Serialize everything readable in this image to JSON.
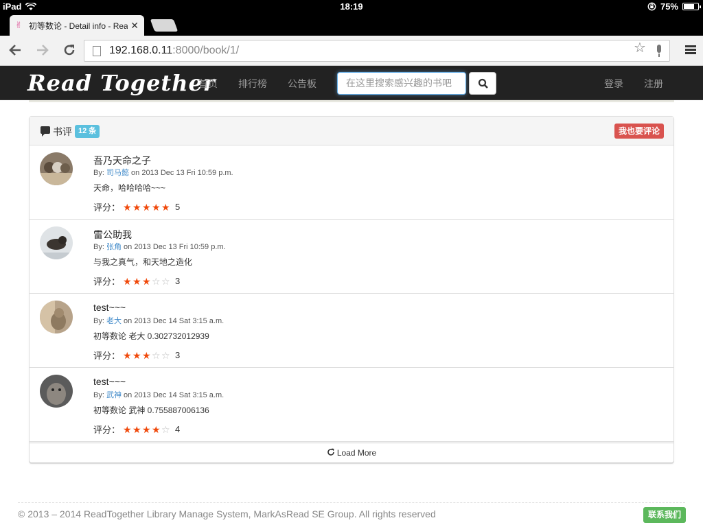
{
  "status_bar": {
    "device": "iPad",
    "time": "18:19",
    "battery": "75%",
    "battery_level": 0.75
  },
  "browser": {
    "tab_title": "初等数论 - Detail info - Rea",
    "url_host": "192.168.0.11",
    "url_path": ":8000/book/1/"
  },
  "navbar": {
    "brand": "Read Together",
    "links": [
      "首页",
      "排行榜",
      "公告板"
    ],
    "search_placeholder": "在这里搜索感兴趣的书吧",
    "login": "登录",
    "register": "注册"
  },
  "reviews_panel": {
    "heading": "书评",
    "count_badge": "12 条",
    "add_review_button": "我也要评论",
    "load_more": "Load More",
    "rating_label": "评分：",
    "by_label": "By:",
    "items": [
      {
        "title": "吾乃天命之子",
        "user": "司马懿",
        "date": "on 2013 Dec 13 Fri 10:59 p.m.",
        "body": "天命，哈哈哈哈~~~",
        "rating": 5,
        "rating_text": "5"
      },
      {
        "title": "雷公助我",
        "user": "张角",
        "date": "on 2013 Dec 13 Fri 10:59 p.m.",
        "body": "与我之真气，和天地之造化",
        "rating": 3,
        "rating_text": "3"
      },
      {
        "title": "test~~~",
        "user": "老大",
        "date": "on 2013 Dec 14 Sat 3:15 a.m.",
        "body": "初等数论 老大 0.302732012939",
        "rating": 3,
        "rating_text": "3"
      },
      {
        "title": "test~~~",
        "user": "武神",
        "date": "on 2013 Dec 14 Sat 3:15 a.m.",
        "body": "初等数论 武神 0.755887006136",
        "rating": 4,
        "rating_text": "4"
      }
    ]
  },
  "footer": {
    "copyright": "© 2013 – 2014 ReadTogether Library Manage System, MarkAsRead SE Group. All rights reserved",
    "contact_button": "联系我们"
  },
  "colors": {
    "navbar_bg": "#222222",
    "star_on": "#f0480a",
    "badge_info": "#5bc0de",
    "btn_danger": "#d9534f",
    "btn_success": "#5cb85c",
    "link": "#428bca"
  }
}
